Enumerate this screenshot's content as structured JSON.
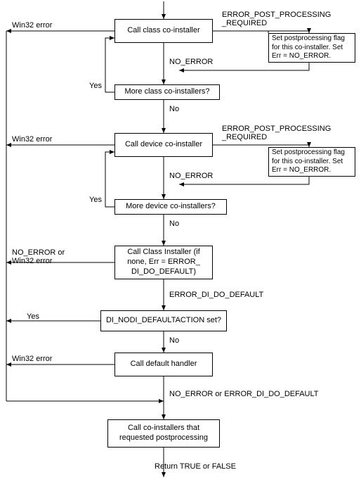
{
  "chart_data": {
    "type": "flowchart",
    "nodes": [
      {
        "id": "n1",
        "text": "Call\nclass co-installer"
      },
      {
        "id": "s1",
        "text": "Set postprocessing\nflag for this co-installer.\nSet Err = NO_ERROR."
      },
      {
        "id": "d1",
        "text": "More class co-installers?"
      },
      {
        "id": "n2",
        "text": "Call\ndevice co-installer"
      },
      {
        "id": "s2",
        "text": "Set postprocessing\nflag for this co-installer.\nSet Err = NO_ERROR."
      },
      {
        "id": "d2",
        "text": "More device co-installers?"
      },
      {
        "id": "n3",
        "text": "Call Class Installer\n(if none, Err = ERROR_\nDI_DO_DEFAULT)"
      },
      {
        "id": "d3",
        "text": "DI_NODI_DEFAULTACTION\nset?"
      },
      {
        "id": "n4",
        "text": "Call\ndefault handler"
      },
      {
        "id": "n5",
        "text": "Call co-installers that\nrequested postprocessing"
      }
    ],
    "edge_labels": {
      "win32": "Win32 error",
      "epp": "ERROR_POST_PROCESSING\n_REQUIRED",
      "noerr": "NO_ERROR",
      "yes": "Yes",
      "no": "No",
      "noerr_or_win32": "NO_ERROR or\nWin32 error",
      "eddd": "ERROR_DI_DO_DEFAULT",
      "final_branch": "NO_ERROR or ERROR_DI_DO_DEFAULT",
      "ret": "Return TRUE or FALSE"
    }
  }
}
